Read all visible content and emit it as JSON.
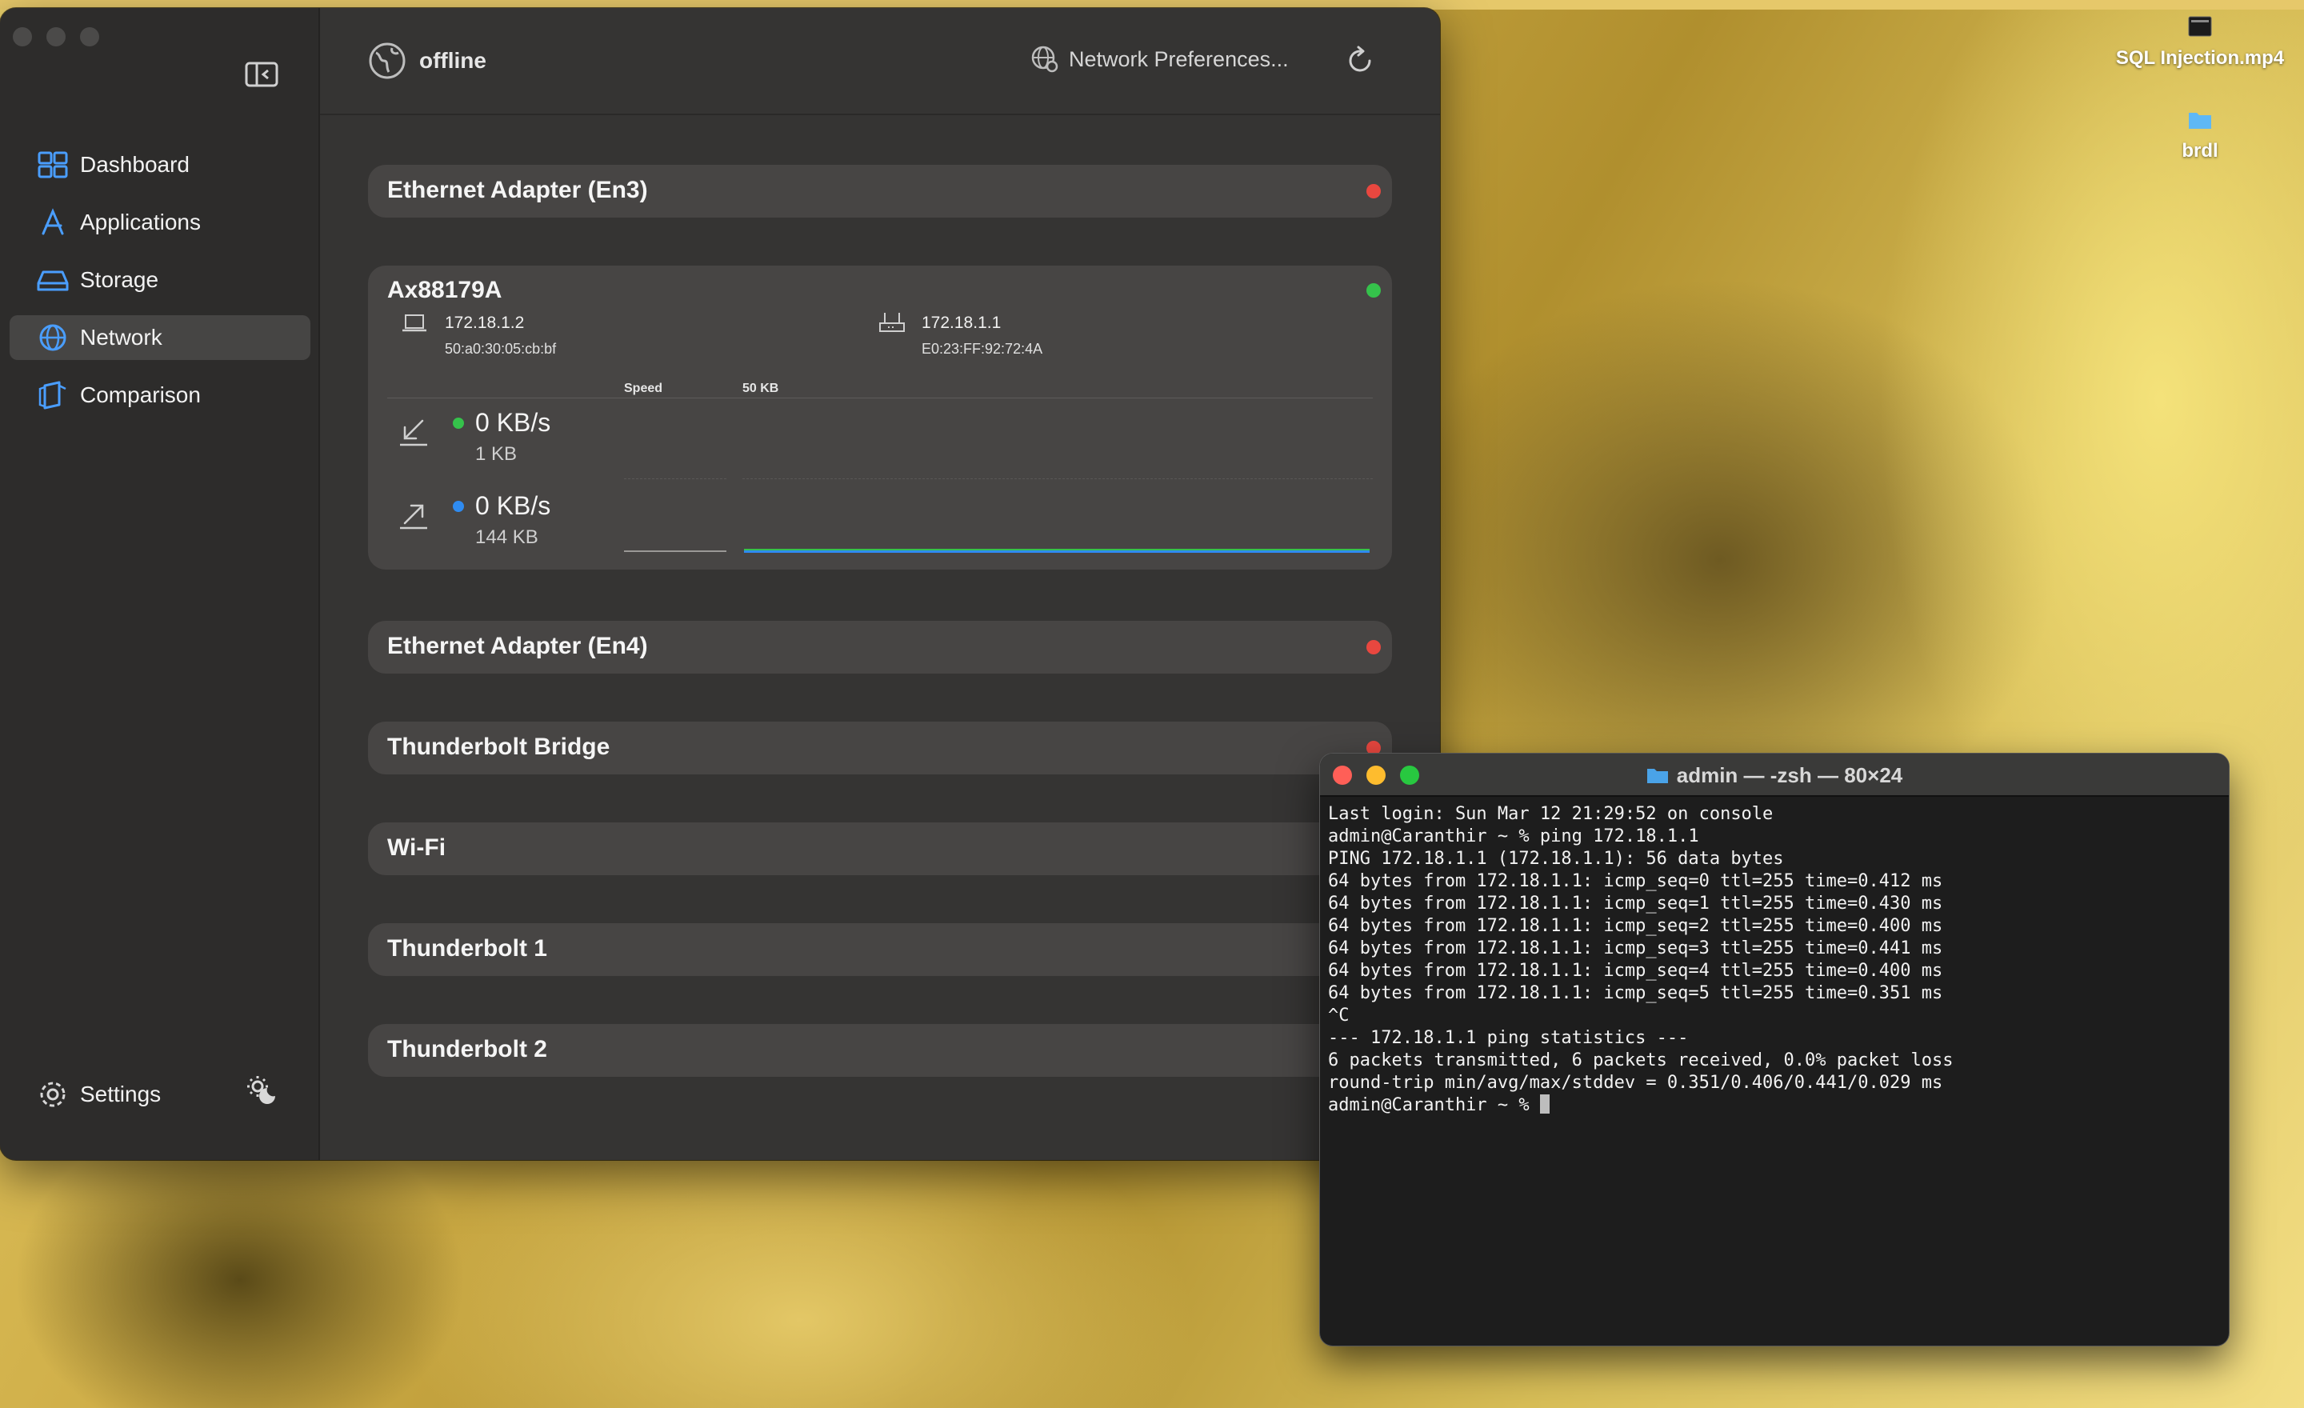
{
  "desktop": {
    "icons": [
      {
        "label": "SQL Injection.mp4"
      },
      {
        "label": "brdl"
      }
    ]
  },
  "sidebar": {
    "items": [
      {
        "label": "Dashboard",
        "icon": "dashboard-icon"
      },
      {
        "label": "Applications",
        "icon": "applications-icon"
      },
      {
        "label": "Storage",
        "icon": "storage-icon"
      },
      {
        "label": "Network",
        "icon": "globe-icon",
        "active": true
      },
      {
        "label": "Comparison",
        "icon": "comparison-icon"
      }
    ],
    "settings_label": "Settings"
  },
  "header": {
    "status": "offline",
    "prefs_label": "Network Preferences..."
  },
  "interfaces": {
    "en3": {
      "name": "Ethernet Adapter (En3)",
      "status_color": "#e9473f"
    },
    "ax": {
      "name": "Ax88179A",
      "status_color": "#35c24b",
      "local_ip": "172.18.1.2",
      "local_mac": "50:a0:30:05:cb:bf",
      "router_ip": "172.18.1.1",
      "router_mac": "E0:23:FF:92:72:4A",
      "speed_label": "Speed",
      "scale_label": "50 KB",
      "download": {
        "rate": "0 KB/s",
        "total": "1 KB",
        "color": "#35c24b"
      },
      "upload": {
        "rate": "0 KB/s",
        "total": "144 KB",
        "color": "#2f8bf0"
      }
    },
    "en4": {
      "name": "Ethernet Adapter (En4)",
      "status_color": "#e9473f"
    },
    "tb_bridge": {
      "name": "Thunderbolt Bridge",
      "status_color": "#e9473f"
    },
    "wifi": {
      "name": "Wi-Fi"
    },
    "tb1": {
      "name": "Thunderbolt 1"
    },
    "tb2": {
      "name": "Thunderbolt 2"
    }
  },
  "terminal": {
    "title": "admin — -zsh — 80×24",
    "lines": [
      "Last login: Sun Mar 12 21:29:52 on console",
      "admin@Caranthir ~ % ping 172.18.1.1",
      "PING 172.18.1.1 (172.18.1.1): 56 data bytes",
      "64 bytes from 172.18.1.1: icmp_seq=0 ttl=255 time=0.412 ms",
      "64 bytes from 172.18.1.1: icmp_seq=1 ttl=255 time=0.430 ms",
      "64 bytes from 172.18.1.1: icmp_seq=2 ttl=255 time=0.400 ms",
      "64 bytes from 172.18.1.1: icmp_seq=3 ttl=255 time=0.441 ms",
      "64 bytes from 172.18.1.1: icmp_seq=4 ttl=255 time=0.400 ms",
      "64 bytes from 172.18.1.1: icmp_seq=5 ttl=255 time=0.351 ms",
      "^C",
      "--- 172.18.1.1 ping statistics ---",
      "6 packets transmitted, 6 packets received, 0.0% packet loss",
      "round-trip min/avg/max/stddev = 0.351/0.406/0.441/0.029 ms"
    ],
    "prompt": "admin@Caranthir ~ % "
  }
}
